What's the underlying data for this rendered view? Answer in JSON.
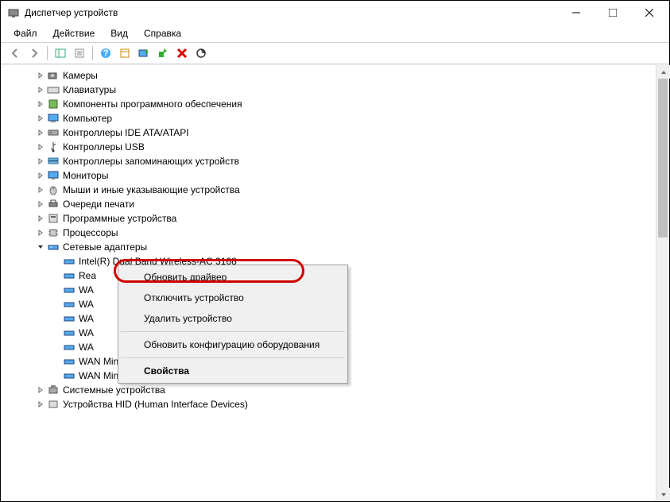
{
  "window": {
    "title": "Диспетчер устройств"
  },
  "menu": {
    "file": "Файл",
    "action": "Действие",
    "view": "Вид",
    "help": "Справка"
  },
  "tree": {
    "cameras": "Камеры",
    "keyboards": "Клавиатуры",
    "software_components": "Компоненты программного обеспечения",
    "computer": "Компьютер",
    "ide_controllers": "Контроллеры IDE ATA/ATAPI",
    "usb_controllers": "Контроллеры USB",
    "storage_controllers": "Контроллеры запоминающих устройств",
    "monitors": "Мониторы",
    "mice": "Мыши и иные указывающие устройства",
    "print_queues": "Очереди печати",
    "software_devices": "Программные устройства",
    "processors": "Процессоры",
    "network_adapters": "Сетевые адаптеры",
    "net_intel": "Intel(R) Dual Band Wireless-AC 3168",
    "net_rea": "Rea",
    "net_wa1": "WA",
    "net_wa2": "WA",
    "net_wa3": "WA",
    "net_wa4": "WA",
    "net_wa5": "WA",
    "net_pptp": "WAN Miniport (PPTP)",
    "net_sstp": "WAN Miniport (SSTP)",
    "system_devices": "Системные устройства",
    "hid_devices": "Устройства HID (Human Interface Devices)"
  },
  "ctx": {
    "update_driver": "Обновить драйвер",
    "disable_device": "Отключить устройство",
    "remove_device": "Удалить устройство",
    "refresh_hw": "Обновить конфигурацию оборудования",
    "properties": "Свойства"
  }
}
